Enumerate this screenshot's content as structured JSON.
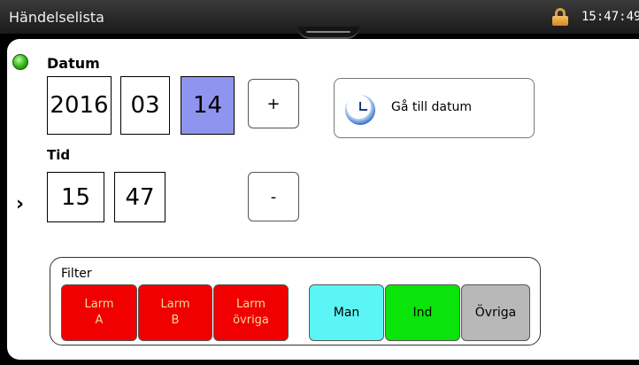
{
  "window": {
    "title": "Händelselista",
    "time": "15:47:49"
  },
  "date": {
    "label": "Datum",
    "year": "2016",
    "month": "03",
    "day": "14",
    "plus": "+",
    "goto_label": "Gå till datum"
  },
  "time": {
    "label": "Tid",
    "hour": "15",
    "minute": "47",
    "minus": "-",
    "pointer": "›"
  },
  "filter": {
    "label": "Filter",
    "buttons": [
      {
        "line1": "Larm",
        "line2": "A",
        "color": "#f00000"
      },
      {
        "line1": "Larm",
        "line2": "B",
        "color": "#f00000"
      },
      {
        "line1": "Larm",
        "line2": "övriga",
        "color": "#f00000"
      },
      {
        "line1": "Man",
        "line2": "",
        "color": "#5cf5f5"
      },
      {
        "line1": "Ind",
        "line2": "",
        "color": "#0ae40a"
      },
      {
        "line1": "Övriga",
        "line2": "",
        "color": "#b8b8b8"
      }
    ]
  },
  "icons": {
    "lock": "lock-icon",
    "clock": "clock-icon",
    "status": "status-indicator-icon"
  },
  "colors": {
    "selected_field": "#8f95ef",
    "status_ok": "#2fb214"
  }
}
